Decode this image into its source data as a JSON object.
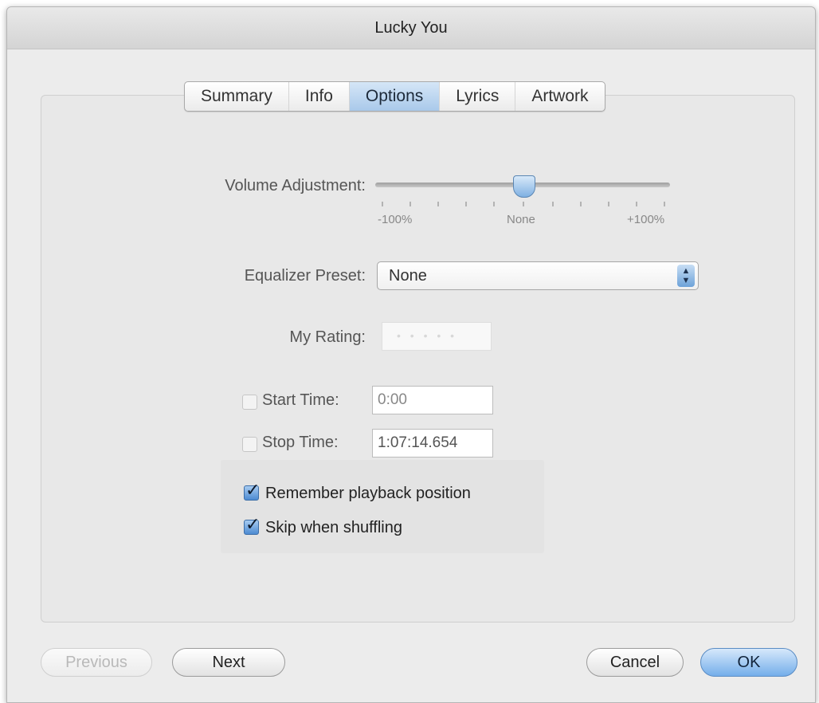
{
  "window": {
    "title": "Lucky You"
  },
  "tabs": [
    {
      "label": "Summary",
      "active": false
    },
    {
      "label": "Info",
      "active": false
    },
    {
      "label": "Options",
      "active": true
    },
    {
      "label": "Lyrics",
      "active": false
    },
    {
      "label": "Artwork",
      "active": false
    }
  ],
  "volume": {
    "label": "Volume Adjustment:",
    "min_label": "-100%",
    "mid_label": "None",
    "max_label": "+100%",
    "value_percent": 0
  },
  "equalizer": {
    "label": "Equalizer Preset:",
    "selected": "None"
  },
  "rating": {
    "label": "My Rating:",
    "stars": 0,
    "placeholder": "• • • • •"
  },
  "start_time": {
    "label": "Start Time:",
    "value": "0:00",
    "checked": false
  },
  "stop_time": {
    "label": "Stop Time:",
    "value": "1:07:14.654",
    "checked": false
  },
  "remember_playback": {
    "label": "Remember playback position",
    "checked": true
  },
  "skip_shuffle": {
    "label": "Skip when shuffling",
    "checked": true
  },
  "buttons": {
    "previous": "Previous",
    "next": "Next",
    "cancel": "Cancel",
    "ok": "OK"
  },
  "colors": {
    "accent": "#74aeea",
    "window_bg": "#ececec"
  }
}
